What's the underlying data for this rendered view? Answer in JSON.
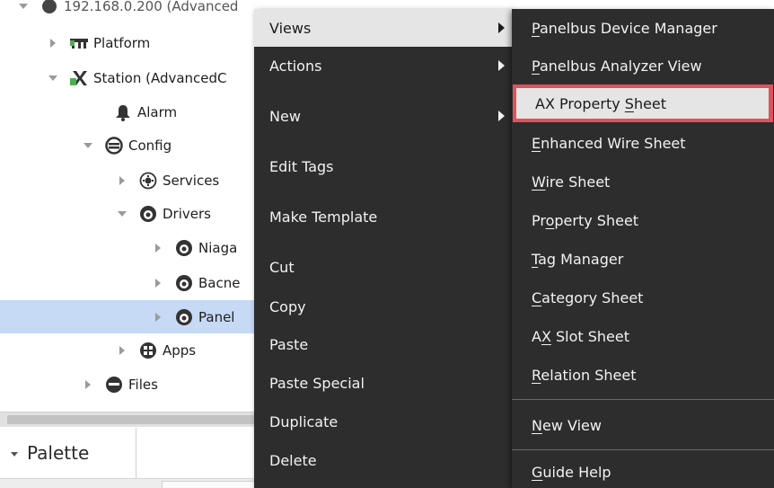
{
  "nav_tree": {
    "nodes": [
      {
        "label": "192.168.0.200 (Advanced",
        "icon": "host-icon"
      },
      {
        "label": "Platform",
        "icon": "platform-icon"
      },
      {
        "label": "Station (AdvancedC",
        "icon": "station-icon"
      },
      {
        "label": "Alarm",
        "icon": "bell-icon"
      },
      {
        "label": "Config",
        "icon": "database-icon"
      },
      {
        "label": "Services",
        "icon": "services-icon"
      },
      {
        "label": "Drivers",
        "icon": "driver-icon"
      },
      {
        "label": "Niaga",
        "icon": "network-icon"
      },
      {
        "label": "Bacne",
        "icon": "network-icon"
      },
      {
        "label": "Panel",
        "icon": "network-icon"
      },
      {
        "label": "Apps",
        "icon": "apps-icon"
      },
      {
        "label": "Files",
        "icon": "files-icon"
      }
    ]
  },
  "palette": {
    "title": "Palette"
  },
  "context_menu": {
    "items": [
      {
        "label": "Views",
        "has_submenu": true
      },
      {
        "label": "Actions",
        "has_submenu": true
      },
      {
        "label": "New",
        "has_submenu": true
      },
      {
        "label": "Edit Tags"
      },
      {
        "label": "Make Template"
      },
      {
        "label": "Cut"
      },
      {
        "label": "Copy"
      },
      {
        "label": "Paste"
      },
      {
        "label": "Paste Special"
      },
      {
        "label": "Duplicate"
      },
      {
        "label": "Delete"
      }
    ]
  },
  "views_submenu": {
    "items": [
      {
        "pre": "",
        "u": "P",
        "post": "anelbus Device Manager"
      },
      {
        "pre": "",
        "u": "P",
        "post": "anelbus Analyzer View"
      },
      {
        "pre": "AX Property ",
        "u": "S",
        "post": "heet"
      },
      {
        "pre": "",
        "u": "E",
        "post": "nhanced Wire Sheet"
      },
      {
        "pre": "",
        "u": "W",
        "post": "ire Sheet"
      },
      {
        "pre": "Pr",
        "u": "o",
        "post": "perty Sheet"
      },
      {
        "pre": "",
        "u": "T",
        "post": "ag Manager"
      },
      {
        "pre": "",
        "u": "C",
        "post": "ategory Sheet"
      },
      {
        "pre": "A",
        "u": "X",
        "post": " Slot Sheet"
      },
      {
        "pre": "",
        "u": "R",
        "post": "elation Sheet"
      },
      {
        "pre": "",
        "u": "N",
        "post": "ew View"
      },
      {
        "pre": "",
        "u": "G",
        "post": "uide Help"
      }
    ]
  },
  "colors": {
    "menu_background": "#2d2d2d",
    "menu_text": "#f2f2f2",
    "hover_background": "#e5e5e5",
    "highlight_border": "#e0525a",
    "tree_selection": "#c6d9f5"
  }
}
